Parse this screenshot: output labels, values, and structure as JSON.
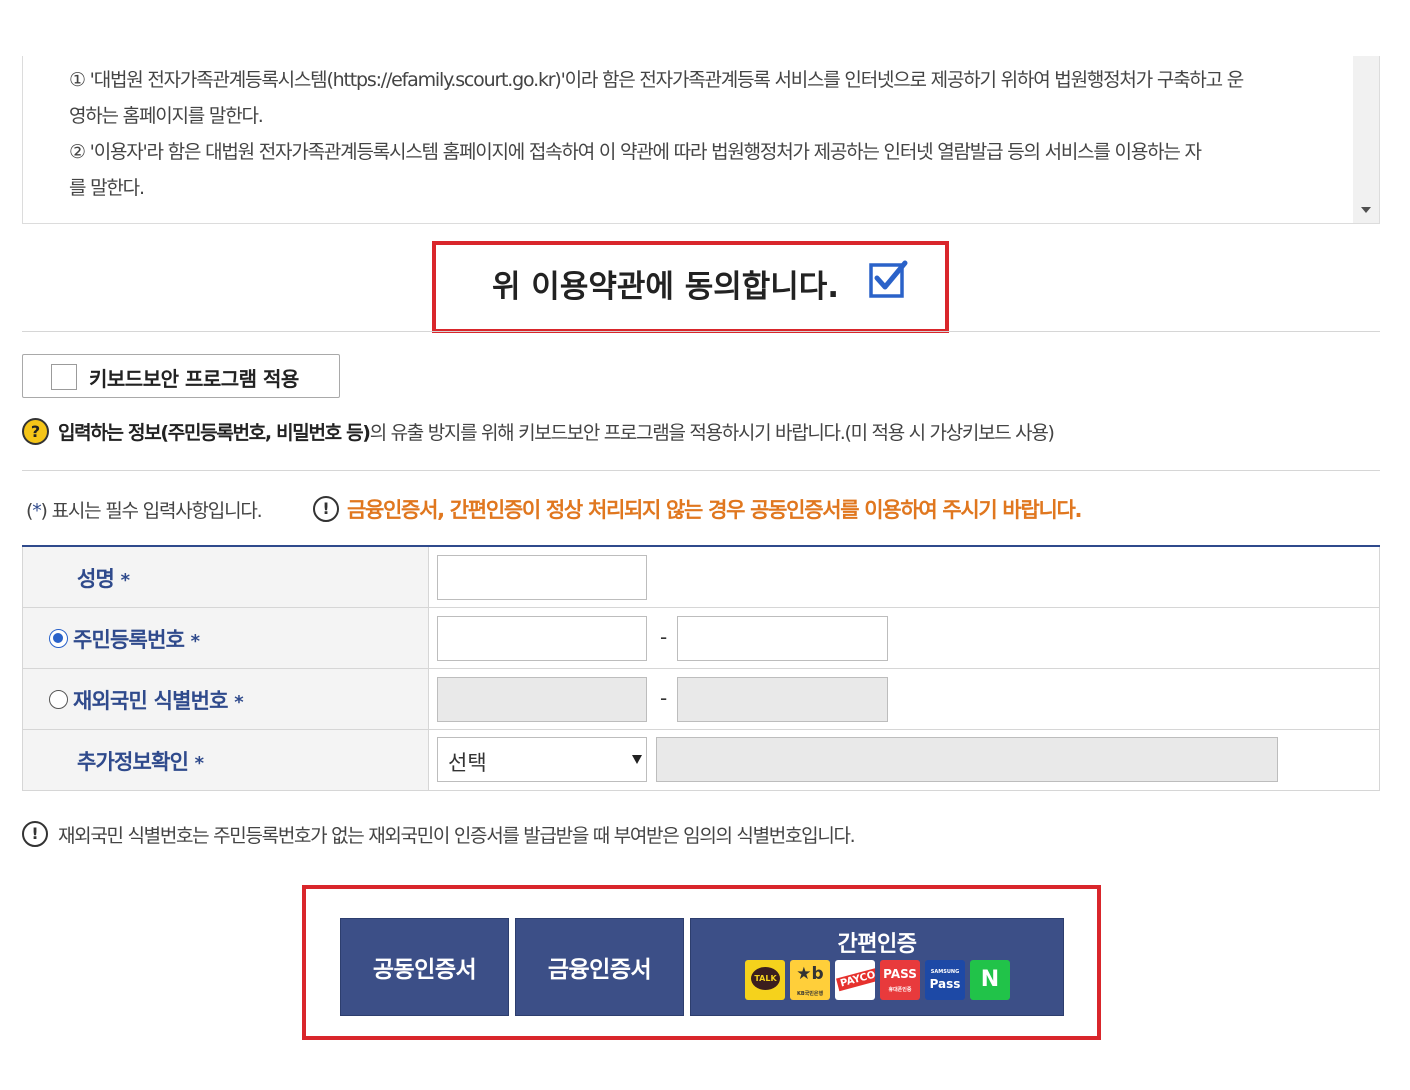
{
  "terms": {
    "line1": "① '대법원 전자가족관계등록시스템(https://efamily.scourt.go.kr)'이라 함은 전자가족관계등록 서비스를 인터넷으로 제공하기 위하여 법원행정처가 구축하고 운",
    "line2": "영하는 홈페이지를 말한다.",
    "line3": "② '이용자'라 함은 대법원 전자가족관계등록시스템 홈페이지에 접속하여 이 약관에 따라 법원행정처가 제공하는 인터넷 열람발급 등의 서비스를 이용하는 자",
    "line4": "를 말한다."
  },
  "agree": {
    "label": "위 이용약관에 동의합니다.",
    "checked": true
  },
  "keyboard": {
    "label": "키보드보안 프로그램 적용",
    "checked": false,
    "note_icon": "?",
    "note_bold": "입력하는 정보(주민등록번호, 비밀번호 등)",
    "note_rest": "의 유출 방지를 위해 키보드보안 프로그램을 적용하시기 바랍니다.(미 적용 시 가상키보드 사용)"
  },
  "required": {
    "open": "(",
    "star": "*",
    "text": ") 표시는 필수 입력사항입니다.",
    "warn_icon": "!",
    "warning": "금융인증서, 간편인증이 정상 처리되지 않는 경우 공동인증서를 이용하여 주시기 바랍니다."
  },
  "form": {
    "star": "*",
    "name_label": "성명",
    "rrn_label": "주민등록번호",
    "foreign_label": "재외국민 식별번호",
    "extra_label": "추가정보확인",
    "dash": "-",
    "select_value": "선택",
    "rrn_selected": true
  },
  "foreign_note": {
    "icon": "!",
    "text": "재외국민 식별번호는 주민등록번호가 없는 재외국민이 인증서를 발급받을 때 부여받은 임의의 식별번호입니다."
  },
  "cert": {
    "joint": "공동인증서",
    "financial": "금융인증서",
    "simple": "간편인증",
    "logos": {
      "talk": "TALK",
      "kb": "★b",
      "kb_sub": "KB국민은행",
      "payco": "PAYCO",
      "pass": "PASS",
      "pass_sub": "휴대폰인증",
      "spass_top": "SAMSUNG",
      "spass": "Pass",
      "naver": "N"
    }
  },
  "colors": {
    "accent": "#2f4a8c",
    "button": "#3c4f87",
    "warning": "#e0771f",
    "highlight_border": "#d9262b",
    "check": "#2a62c9"
  }
}
